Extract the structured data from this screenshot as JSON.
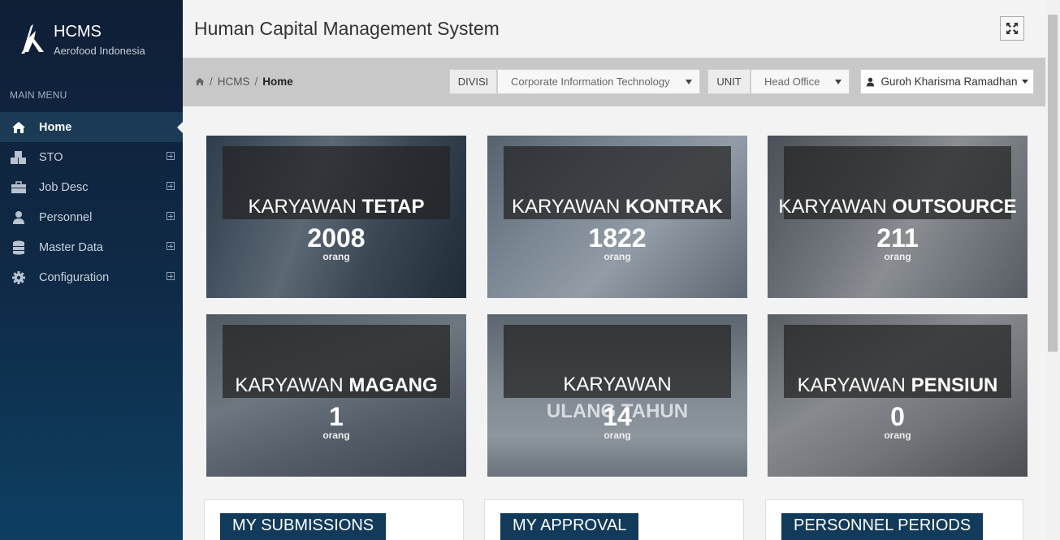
{
  "app": {
    "name": "HCMS",
    "company": "Aerofood Indonesia"
  },
  "sidebar": {
    "heading": "MAIN MENU",
    "items": [
      {
        "label": "Home",
        "icon": "home-icon",
        "active": true
      },
      {
        "label": "STO",
        "icon": "cubes-icon",
        "expandable": true
      },
      {
        "label": "Job Desc",
        "icon": "briefcase-icon",
        "expandable": true
      },
      {
        "label": "Personnel",
        "icon": "user-icon",
        "expandable": true
      },
      {
        "label": "Master Data",
        "icon": "database-icon",
        "expandable": true
      },
      {
        "label": "Configuration",
        "icon": "gear-icon",
        "expandable": true
      }
    ]
  },
  "header": {
    "title": "Human Capital Management System",
    "fullscreen_icon": "expand-icon"
  },
  "breadcrumb": {
    "root": "HCMS",
    "current": "Home"
  },
  "filters": {
    "divisi": {
      "label": "DIVISI",
      "value": "Corporate Information Technology"
    },
    "unit": {
      "label": "UNIT",
      "value": "Head Office"
    }
  },
  "user": {
    "name": "Guroh Kharisma Ramadhan"
  },
  "cards": [
    {
      "title_light": "KARYAWAN",
      "title_bold": "TETAP",
      "count": "2008",
      "unit": "orang"
    },
    {
      "title_light": "KARYAWAN",
      "title_bold": "KONTRAK",
      "count": "1822",
      "unit": "orang"
    },
    {
      "title_light": "KARYAWAN",
      "title_bold": "OUTSOURCE",
      "count": "211",
      "unit": "orang"
    },
    {
      "title_light": "KARYAWAN",
      "title_bold": "MAGANG",
      "count": "1",
      "unit": "orang"
    },
    {
      "title_light": "KARYAWAN",
      "title_bold": "ULANG TAHUN",
      "count": "14",
      "unit": "orang"
    },
    {
      "title_light": "KARYAWAN",
      "title_bold": "PENSIUN",
      "count": "0",
      "unit": "orang"
    }
  ],
  "panels": [
    "MY SUBMISSIONS",
    "MY APPROVAL",
    "PERSONNEL PERIODS"
  ],
  "colors": {
    "sidebar": "#0f2b48",
    "accent": "#123a5a",
    "toolbar": "#c8c8c8"
  }
}
